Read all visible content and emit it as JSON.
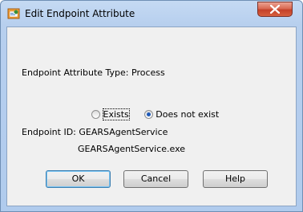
{
  "window": {
    "title": "Edit Endpoint Attribute"
  },
  "titlebar_icons": {
    "app": "window-app-icon",
    "close": "close-icon"
  },
  "form": {
    "attribute_type_label": "Endpoint Attribute Type:",
    "attribute_type_value": "Process",
    "radio_exists_label": "Exists",
    "radio_not_exist_label": "Does not exist",
    "selected_option": "Does not exist",
    "endpoint_id_label": "Endpoint ID:",
    "endpoint_id_line1": "GEARSAgentService",
    "endpoint_id_line2": "GEARSAgentService.exe"
  },
  "buttons": {
    "ok": "OK",
    "cancel": "Cancel",
    "help": "Help"
  },
  "colors": {
    "title_bar": "#c5daf3",
    "close_button": "#d96a53",
    "client_bg": "#f0f0f0"
  }
}
